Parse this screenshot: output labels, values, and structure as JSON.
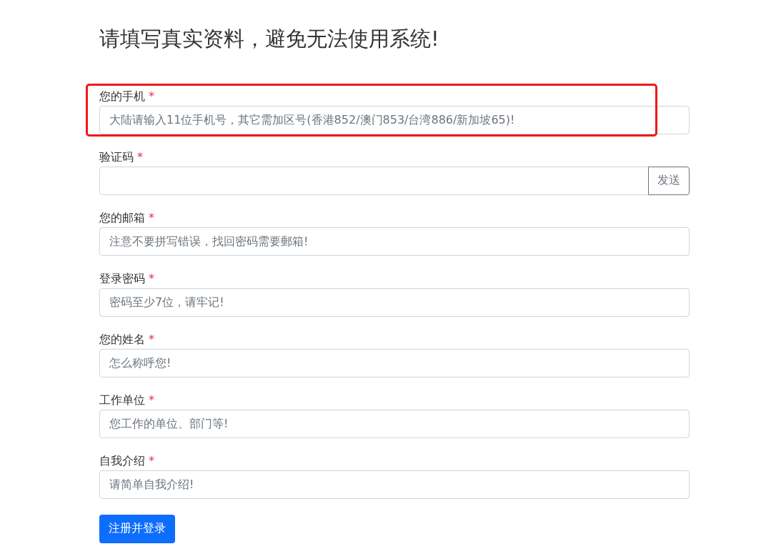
{
  "title": "请填写真实资料，避免无法使用系统!",
  "fields": [
    {
      "kind": "text",
      "label": "您的手机",
      "required_mark": "*",
      "placeholder": "大陆请输入11位手机号，其它需加区号(香港852/澳门853/台湾886/新加坡65)!",
      "highlighted": true
    },
    {
      "kind": "code",
      "label": "验证码",
      "required_mark": "*",
      "button": "发送",
      "highlighted": false
    },
    {
      "kind": "text",
      "label": "您的邮箱",
      "required_mark": "*",
      "placeholder": "注意不要拼写错误，找回密码需要郵箱!",
      "highlighted": false
    },
    {
      "kind": "text",
      "label": "登录密码",
      "required_mark": "*",
      "placeholder": "密码至少7位，请牢记!",
      "highlighted": false
    },
    {
      "kind": "text",
      "label": "您的姓名",
      "required_mark": "*",
      "placeholder": "怎么称呼您!",
      "highlighted": false
    },
    {
      "kind": "text",
      "label": "工作单位",
      "required_mark": "*",
      "placeholder": "您工作的单位、部门等!",
      "highlighted": false
    },
    {
      "kind": "text",
      "label": "自我介绍",
      "required_mark": "*",
      "placeholder": "请简单自我介绍!",
      "highlighted": false
    }
  ],
  "submit": "注册并登录"
}
